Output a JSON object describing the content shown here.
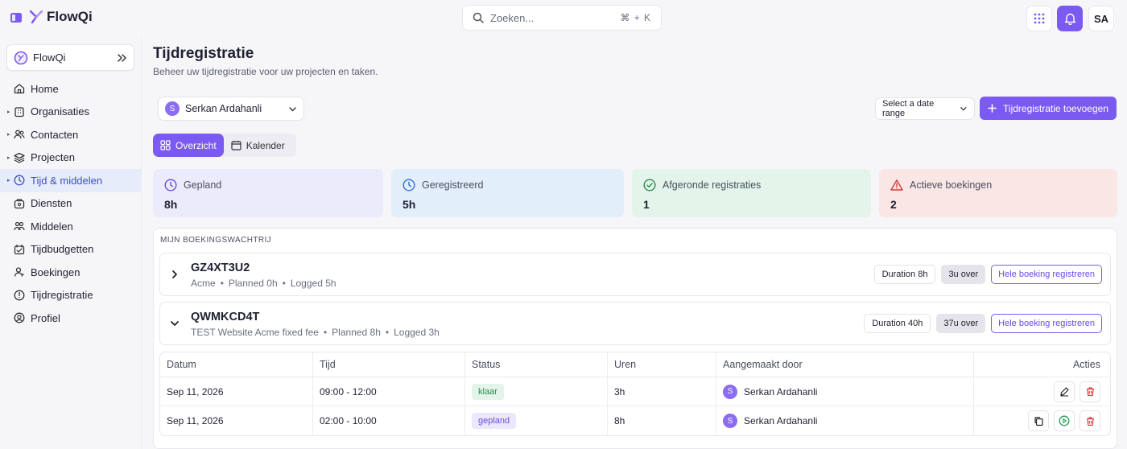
{
  "header": {
    "brand": "FlowQi",
    "search_placeholder": "Zoeken...",
    "search_shortcut": "⌘ + K",
    "user_initials": "SA"
  },
  "sidebar": {
    "org": "FlowQi",
    "items": [
      {
        "label": "Home",
        "icon": "home-icon",
        "caret": false
      },
      {
        "label": "Organisaties",
        "icon": "building-icon",
        "caret": true
      },
      {
        "label": "Contacten",
        "icon": "users-icon",
        "caret": true
      },
      {
        "label": "Projecten",
        "icon": "layers-icon",
        "caret": true
      },
      {
        "label": "Tijd & middelen",
        "icon": "clock-icon",
        "caret": true,
        "active": true
      },
      {
        "label": "Diensten",
        "icon": "services-icon",
        "caret": false
      },
      {
        "label": "Middelen",
        "icon": "people-icon",
        "caret": false
      },
      {
        "label": "Tijdbudgetten",
        "icon": "budget-icon",
        "caret": false
      },
      {
        "label": "Boekingen",
        "icon": "booking-icon",
        "caret": false
      },
      {
        "label": "Tijdregistratie",
        "icon": "timer-icon",
        "caret": false
      },
      {
        "label": "Profiel",
        "icon": "profile-icon",
        "caret": false
      }
    ]
  },
  "page": {
    "title": "Tijdregistratie",
    "subtitle": "Beheer uw tijdregistratie voor uw projecten en taken.",
    "user_select": {
      "initial": "S",
      "name": "Serkan Ardahanli"
    },
    "date_range": "Select a date range",
    "add_button": "Tijdregistratie toevoegen",
    "tabs": [
      "Overzicht",
      "Kalender"
    ]
  },
  "stats": [
    {
      "label": "Gepland",
      "value": "8h",
      "icon": "clock-icon",
      "bg": "#ecebfb",
      "color": "#6a4be6"
    },
    {
      "label": "Geregistreerd",
      "value": "5h",
      "icon": "clock-icon",
      "bg": "#e3eefb",
      "color": "#2f6fd6"
    },
    {
      "label": "Afgeronde registraties",
      "value": "1",
      "icon": "check-circle-icon",
      "bg": "#e3f5ea",
      "color": "#2a8a4e"
    },
    {
      "label": "Actieve boekingen",
      "value": "2",
      "icon": "warning-icon",
      "bg": "#fbe6e6",
      "color": "#d33a3a"
    }
  ],
  "queue": {
    "title": "MIJN BOEKINGSWACHTRIJ",
    "bookings": [
      {
        "code": "GZ4XT3U2",
        "client": "Acme",
        "planned": "Planned 0h",
        "logged": "Logged 5h",
        "duration": "Duration 8h",
        "over": "3u over",
        "register": "Hele boeking registreren"
      },
      {
        "code": "QWMKCD4T",
        "client": "TEST Website Acme fixed fee",
        "planned": "Planned 8h",
        "logged": "Logged 3h",
        "duration": "Duration 40h",
        "over": "37u over",
        "register": "Hele boeking registreren"
      }
    ],
    "table": {
      "headers": [
        "Datum",
        "Tijd",
        "Status",
        "Uren",
        "Aangemaakt door",
        "Acties"
      ],
      "rows": [
        {
          "date": "Sep 11, 2026",
          "time": "09:00 - 12:00",
          "status": "klaar",
          "hours": "3h",
          "initial": "S",
          "creator": "Serkan Ardahanli"
        },
        {
          "date": "Sep 11, 2026",
          "time": "02:00 - 10:00",
          "status": "gepland",
          "hours": "8h",
          "initial": "S",
          "creator": "Serkan Ardahanli"
        }
      ]
    }
  },
  "colors": {
    "accent": "#7a5af0",
    "active_nav_bg": "#e7ecfa",
    "danger": "#e03b3b",
    "success": "#2a9a5a"
  }
}
